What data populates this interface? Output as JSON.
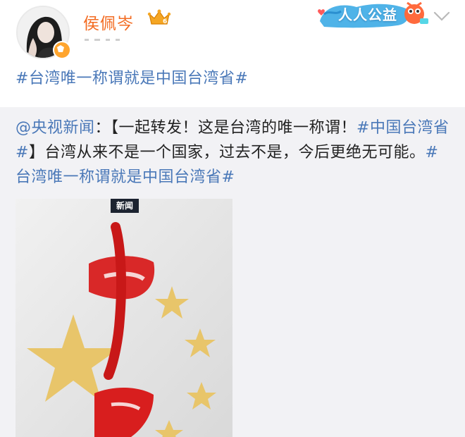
{
  "header": {
    "username": "侯佩岑",
    "charity_badge_label": "人人公益"
  },
  "post": {
    "hashtag": "#台湾唯一称谓就是中国台湾省#"
  },
  "repost": {
    "mention": "@央视新闻",
    "separator": "：",
    "text_part1": "【一起转发！这是台湾的唯一称谓！",
    "hashtag_province": "#中国台湾省#",
    "text_part2": "】台湾从来不是一个国家，过去不是，今后更绝无可能。",
    "hashtag_taiwan": "#台湾唯一称谓就是中国台湾省#"
  },
  "poster": {
    "news_tag": "新闻"
  },
  "colors": {
    "username": "#f36b21",
    "link": "#4a78b8",
    "repost_background": "#f2f2f5",
    "poster_red": "#d81e1e",
    "star_gold": "#e8c56a"
  },
  "icons": [
    "avatar",
    "verified-icon",
    "crown-icon",
    "charity-badge",
    "chevron-down-icon"
  ]
}
